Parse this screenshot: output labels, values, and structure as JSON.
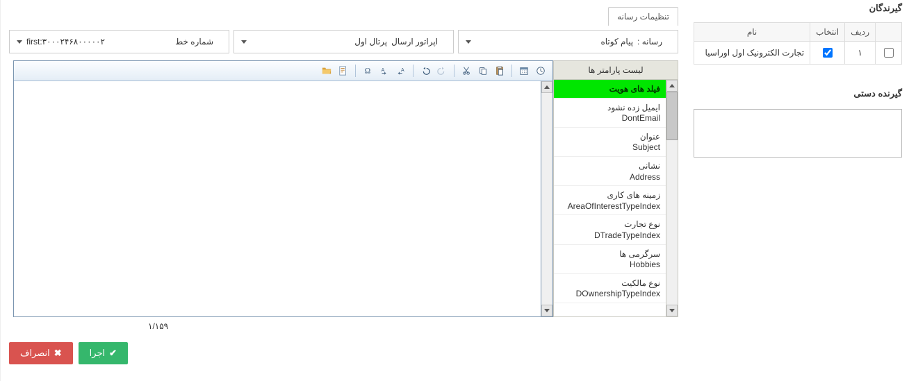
{
  "sidebar": {
    "recipients_title": "گیرندگان",
    "table": {
      "headers": {
        "row": "ردیف",
        "select": "انتخاب",
        "name": "نام"
      },
      "rows": [
        {
          "idx": "۱",
          "selected": true,
          "name": "تجارت الکترونیک اول اوراسیا"
        }
      ]
    },
    "manual_title": "گیرنده دستی",
    "manual_value": ""
  },
  "main": {
    "tab_label": "تنظیمات رسانه",
    "selectors": {
      "media": {
        "label": "رسانه :",
        "value": "پیام کوتاه"
      },
      "operator": {
        "label": "اپراتور ارسال",
        "value": "پرتال اول"
      },
      "line": {
        "label": "شماره خط",
        "value": "first:۳۰۰۰۲۴۶۸۰۰۰۰۰۲"
      }
    },
    "param_panel_title": "لیست پارامتر ها",
    "params": [
      {
        "fa": "فیلد های هویت",
        "en": "",
        "highlight": true
      },
      {
        "fa": "ایمیل زده نشود",
        "en": "DontEmail"
      },
      {
        "fa": "عنوان",
        "en": "Subject"
      },
      {
        "fa": "نشانی",
        "en": "Address"
      },
      {
        "fa": "زمینه های کاری",
        "en": "AreaOfInterestTypeIndex"
      },
      {
        "fa": "نوع تجارت",
        "en": "DTradeTypeIndex"
      },
      {
        "fa": "سرگرمی ها",
        "en": "Hobbies"
      },
      {
        "fa": "نوع مالکیت",
        "en": "DOwnershipTypeIndex"
      }
    ],
    "editor_text": "",
    "counter": "۱/۱۵۹",
    "buttons": {
      "run": "اجرا",
      "cancel": "انصراف"
    }
  }
}
